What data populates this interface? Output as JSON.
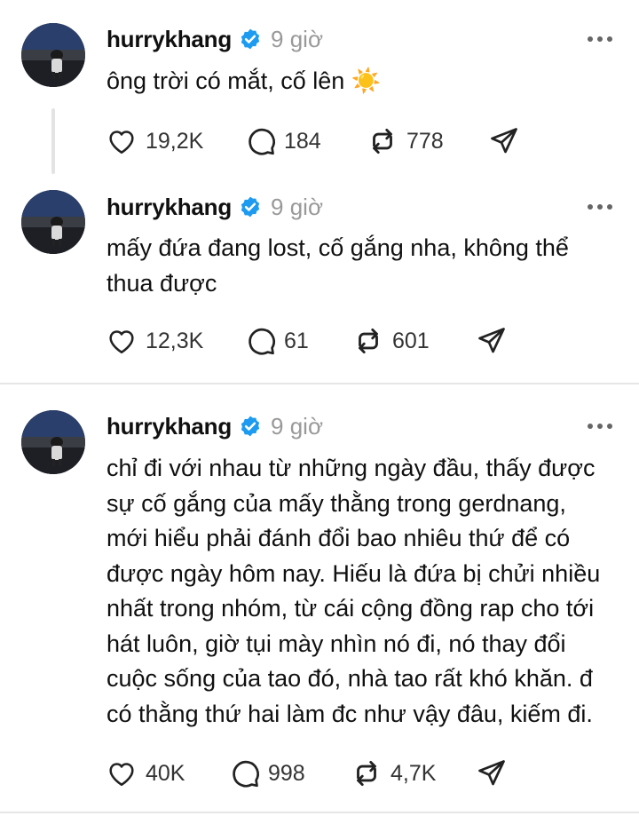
{
  "posts": [
    {
      "username": "hurrykhang",
      "time": "9 giờ",
      "text": "ông trời có mắt, cố lên ☀️",
      "likes": "19,2K",
      "replies": "184",
      "reposts": "778"
    },
    {
      "username": "hurrykhang",
      "time": "9 giờ",
      "text": "mấy đứa đang lost, cố gắng nha, không thể thua được",
      "likes": "12,3K",
      "replies": "61",
      "reposts": "601"
    },
    {
      "username": "hurrykhang",
      "time": "9 giờ",
      "text": "chỉ đi với nhau từ những ngày đầu, thấy được sự cố gắng của mấy thằng trong gerdnang, mới hiểu phải đánh đổi bao nhiêu thứ để có được ngày hôm nay. Hiếu là đứa bị chửi nhiều nhất trong nhóm, từ cái cộng đồng rap cho tới hát luôn, giờ tụi mày nhìn nó đi, nó thay đổi cuộc sống của tao đó, nhà tao rất khó khăn. đ có thằng thứ hai làm đc như vậy đâu, kiếm đi.",
      "likes": "40K",
      "replies": "998",
      "reposts": "4,7K"
    }
  ],
  "icons": {
    "verified": "verified-badge-icon",
    "more": "more-dots-icon",
    "like": "heart-icon",
    "reply": "comment-icon",
    "repost": "repost-icon",
    "share": "send-icon"
  },
  "colors": {
    "verified": "#1d9bf0",
    "muted": "#999999",
    "text": "#101010"
  }
}
